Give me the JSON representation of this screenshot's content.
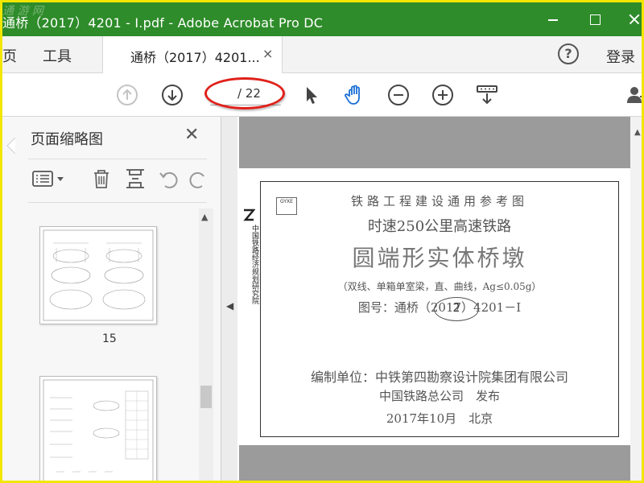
{
  "window": {
    "title": "通桥（2017）4201 - I.pdf - Adobe Acrobat Pro DC",
    "watermark": "通 游 网"
  },
  "tabs": {
    "menu_home": "页",
    "menu_tools": "工具",
    "doc_tab_label": "通桥（2017）4201...",
    "close_symbol": "×",
    "help_symbol": "?",
    "login": "登录"
  },
  "toolbar": {
    "current_page": "",
    "total_pages": "/ 22"
  },
  "sidepanel": {
    "title": "页面缩略图",
    "close_symbol": "✕",
    "thumb1_page_number": "15"
  },
  "document": {
    "side_org": "中国铁路经济规划研究院",
    "small_stamp": "GYXE",
    "line1": "铁路工程建设通用参考图",
    "line2": "时速250公里高速铁路",
    "line3": "圆端形实体桥墩",
    "line4": "（双线、单箱单室梁，直、曲线，Ag≤0.05g）",
    "line5": "图号：通桥（2017）4201－Ⅰ",
    "stamp_text": "2",
    "line6": "编制单位：中铁第四勘察设计院集团有限公司",
    "line7": "中国铁路总公司　发布",
    "line8": "2017年10月　北京"
  },
  "colors": {
    "titlebar": "#2e8c2a",
    "annotation_red": "#e0201a",
    "frame_yellow": "#f3e600",
    "hand_tool_blue": "#1a6fd6"
  }
}
